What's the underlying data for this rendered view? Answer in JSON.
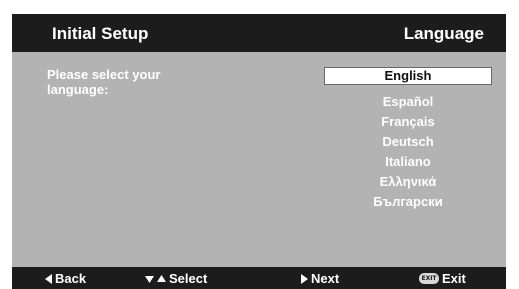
{
  "header": {
    "title": "Initial Setup",
    "section": "Language"
  },
  "prompt": {
    "line1": "Please select your",
    "line2": "language:"
  },
  "languages": {
    "selected_index": 0,
    "items": [
      "English",
      "Español",
      "Français",
      "Deutsch",
      "Italiano",
      "Ελληνικά",
      "Български"
    ]
  },
  "footer": {
    "back_label": "Back",
    "select_label": "Select",
    "next_label": "Next",
    "exit_label": "Exit",
    "exit_key_text": "EXIT",
    "icons": [
      "triangle-left-icon",
      "triangle-down-icon",
      "triangle-up-icon",
      "triangle-right-icon",
      "exit-key-icon"
    ]
  },
  "colors": {
    "panel_background": "#b3b3b3",
    "bar_background": "#1c1c1c",
    "text": "#ffffff",
    "highlight_background": "#ffffff",
    "highlight_text": "#111111"
  }
}
